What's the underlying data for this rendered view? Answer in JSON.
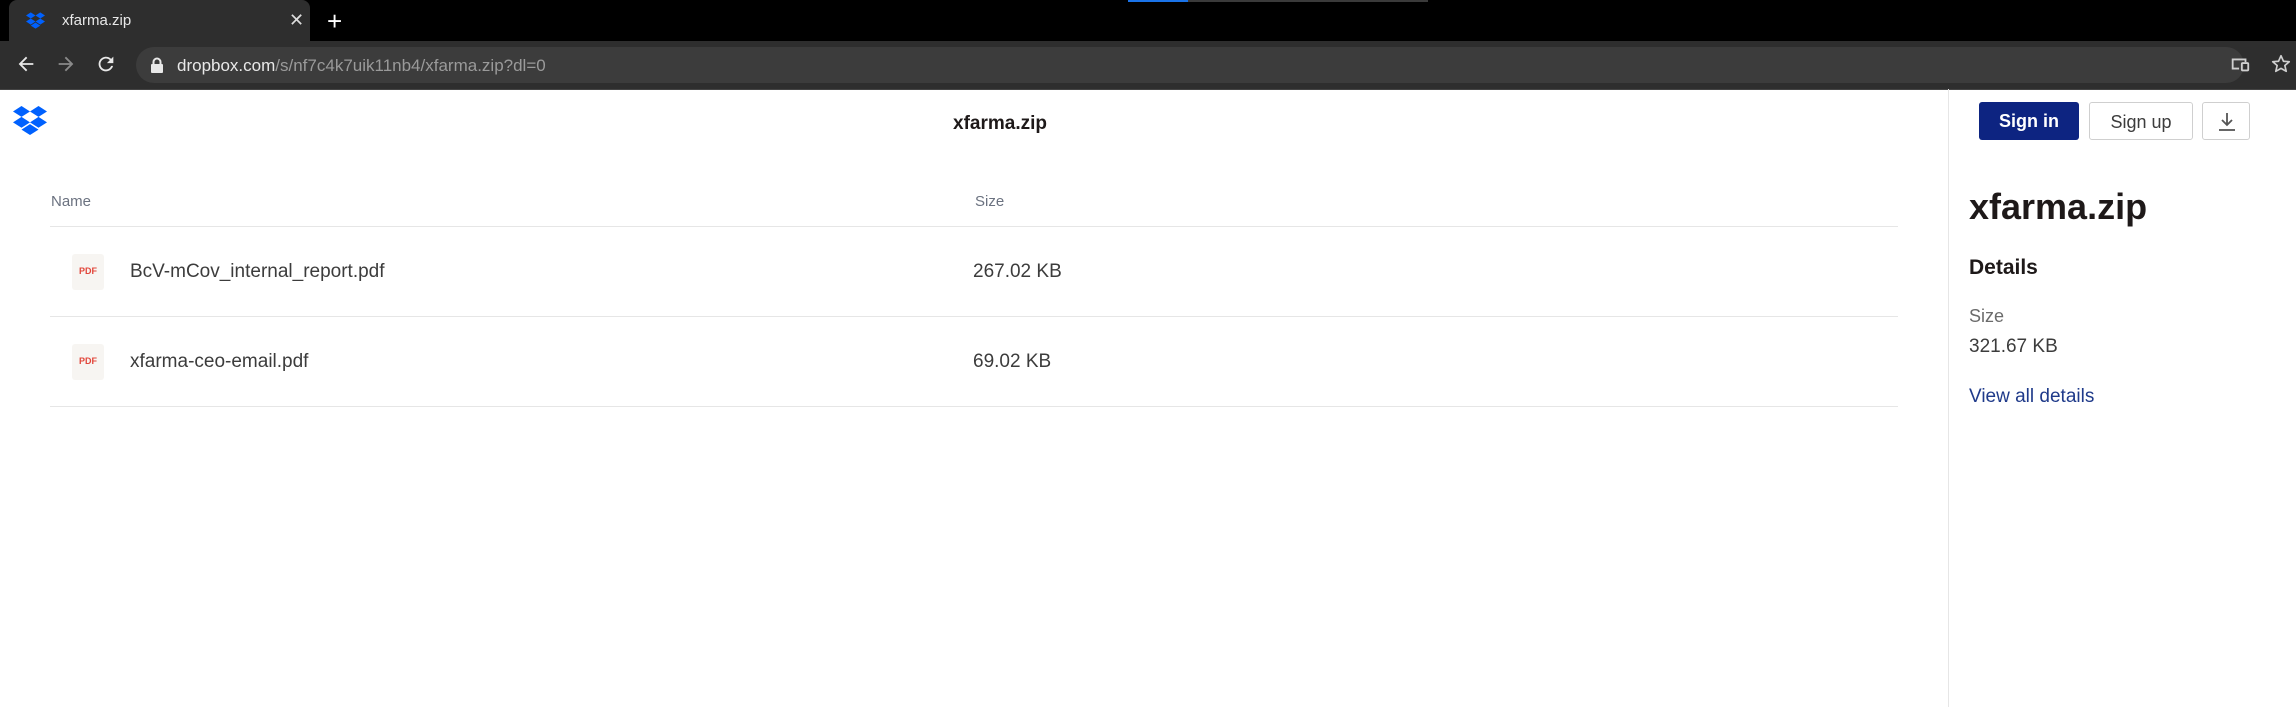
{
  "browser": {
    "tab_title": "xfarma.zip",
    "close_glyph": "✕",
    "newtab_glyph": "+",
    "url_domain": "dropbox.com",
    "url_path": "/s/nf7c4k7uik11nb4/xfarma.zip?dl=0"
  },
  "page": {
    "file_title": "xfarma.zip",
    "columns": {
      "name": "Name",
      "size": "Size"
    },
    "files": [
      {
        "name": "BcV-mCov_internal_report.pdf",
        "size": "267.02 KB",
        "badge": "PDF"
      },
      {
        "name": "xfarma-ceo-email.pdf",
        "size": "69.02 KB",
        "badge": "PDF"
      }
    ]
  },
  "header": {
    "signin_label": "Sign in",
    "signup_label": "Sign up"
  },
  "sidebar": {
    "title": "xfarma.zip",
    "details_heading": "Details",
    "size_label": "Size",
    "size_value": "321.67 KB",
    "view_all_link": "View all details"
  },
  "colors": {
    "brand_blue": "#0061fe",
    "signin_bg": "#0d2481",
    "pdf_red": "#e2463b",
    "link": "#1f3a8a"
  },
  "icons": [
    "dropbox-icon",
    "close-icon",
    "plus-icon",
    "back-icon",
    "forward-icon",
    "reload-icon",
    "lock-icon",
    "cast-icon",
    "star-icon",
    "download-icon",
    "pdf-file-icon"
  ]
}
